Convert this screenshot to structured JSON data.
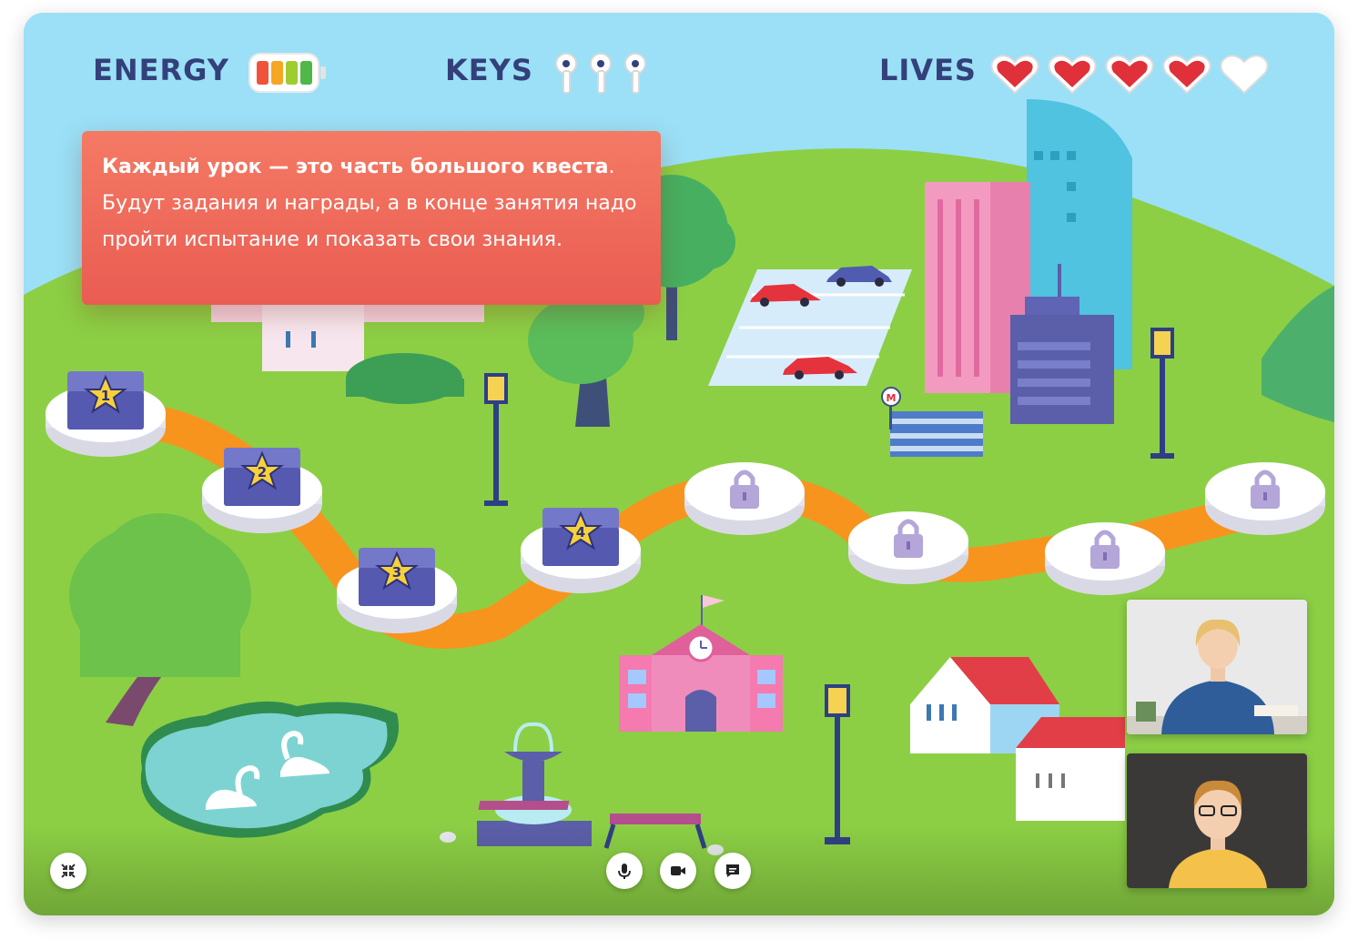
{
  "hud": {
    "energy_label": "ENERGY",
    "keys_label": "KEYS",
    "lives_label": "LIVES",
    "energy_level": 4,
    "energy_max": 4,
    "keys_count": 3,
    "lives_filled": 4,
    "lives_max": 5
  },
  "tip": {
    "bold_text": "Каждый урок — это часть большого квеста",
    "period": ".",
    "text": "Будут задания и награды, а в конце занятия надо пройти испытание и показать свои знания."
  },
  "levels": [
    {
      "label": "1",
      "state": "completed"
    },
    {
      "label": "2",
      "state": "completed"
    },
    {
      "label": "3",
      "state": "completed"
    },
    {
      "label": "4",
      "state": "completed"
    },
    {
      "label": "",
      "state": "locked"
    },
    {
      "label": "",
      "state": "locked"
    },
    {
      "label": "",
      "state": "locked"
    },
    {
      "label": "",
      "state": "locked"
    }
  ],
  "metro_sign": "M",
  "controls": {
    "fullscreen_icon": "collapse-arrows-icon",
    "mic_icon": "microphone-icon",
    "camera_icon": "video-camera-icon",
    "chat_icon": "chat-bubble-icon"
  },
  "colors": {
    "sky": "#9be0f7",
    "grass": "#8ccf45",
    "path": "#f7941d",
    "hud_text": "#33407a",
    "tip_bg": "#ee6a5a",
    "heart": "#e0303a"
  }
}
